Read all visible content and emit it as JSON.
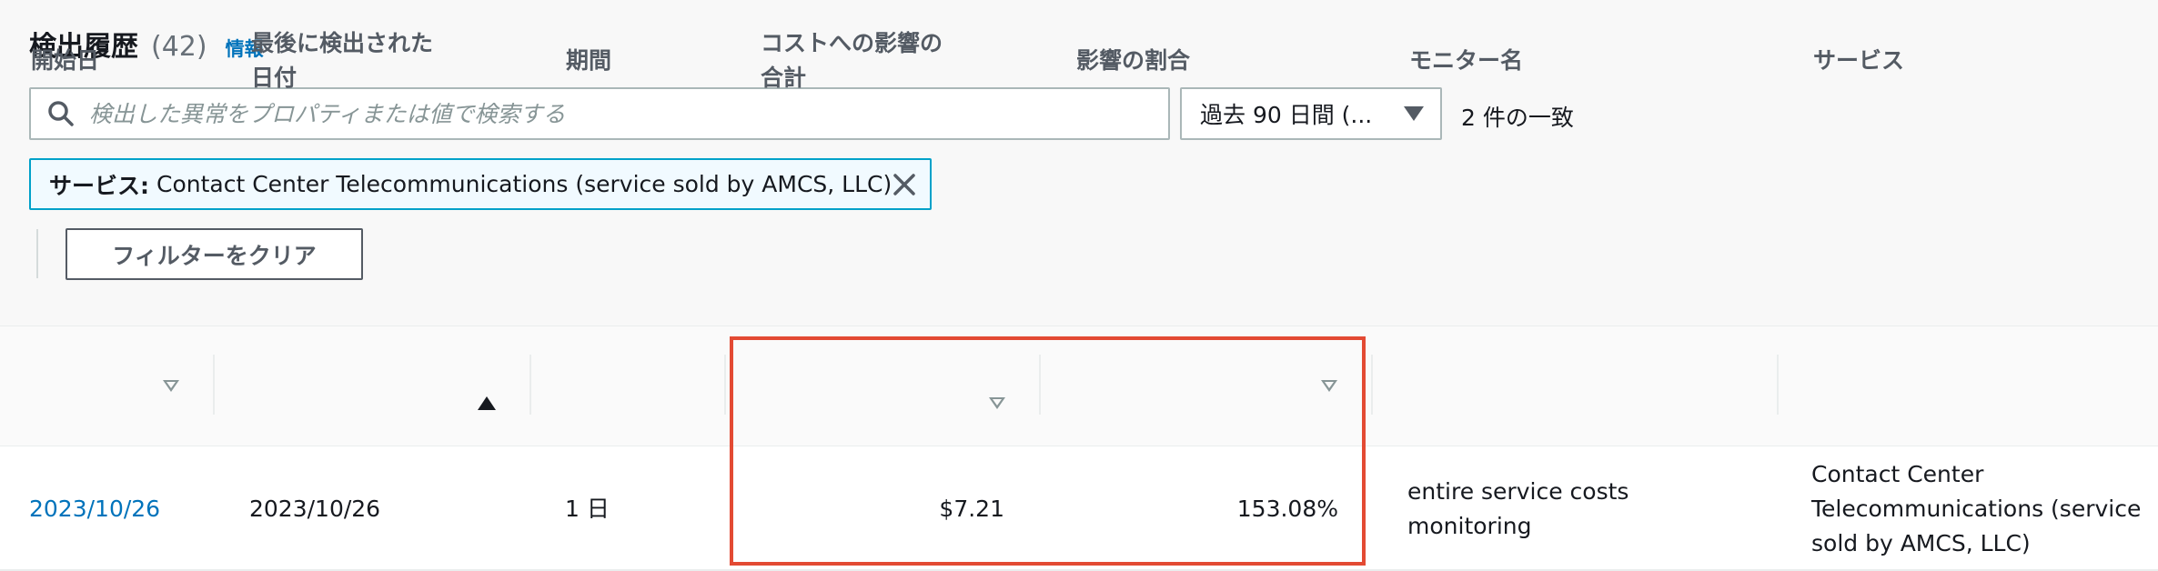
{
  "header": {
    "title": "検出履歴",
    "count": "(42)",
    "info_link": "情報"
  },
  "search": {
    "placeholder": "検出した異常をプロパティまたは値で検索する",
    "value": ""
  },
  "range_select": {
    "selected": "過去 90 日間 (..."
  },
  "match_count": "2 件の一致",
  "filter_token": {
    "key": "サービス:",
    "value": "Contact Center Telecommunications (service sold by AMCS, LLC)"
  },
  "clear_filters_label": "フィルターをクリア",
  "table": {
    "columns": [
      "開始日",
      "最後に検出された\n日付",
      "期間",
      "コストへの影響の\n合計",
      "影響の割合",
      "モニター名",
      "サービス"
    ],
    "rows": [
      {
        "start_date": "2023/10/26",
        "last_detected": "2023/10/26",
        "duration": "1 日",
        "total_cost_impact": "$7.21",
        "impact_percentage": "153.08%",
        "monitor_name": "entire service costs\nmonitoring",
        "service": "Contact Center\nTelecommunications (service\nsold by AMCS, LLC)"
      }
    ]
  },
  "colors": {
    "link": "#0073bb",
    "highlight_border": "#e34a33",
    "token_border": "#00a1c9"
  }
}
